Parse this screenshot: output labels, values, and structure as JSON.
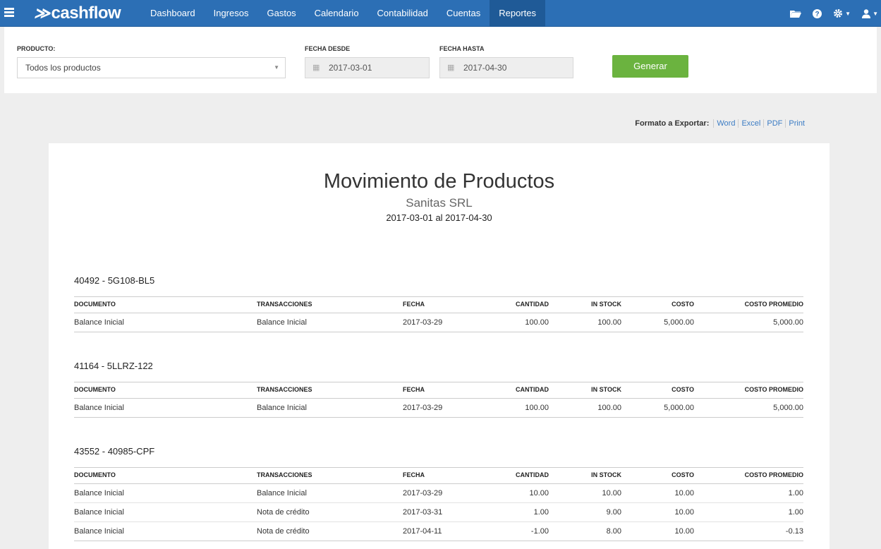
{
  "header": {
    "logo_text": "cashflow",
    "logo_mark": "≫",
    "menu_icon": "hamburger-icon",
    "nav": [
      "Dashboard",
      "Ingresos",
      "Gastos",
      "Calendario",
      "Contabilidad",
      "Cuentas",
      "Reportes"
    ],
    "active_nav": "Reportes",
    "right_icons": [
      "folder-icon",
      "help-icon",
      "gear-icon",
      "user-icon"
    ]
  },
  "filters": {
    "producto_label": "PRODUCTO:",
    "producto_value": "Todos los productos",
    "desde_label": "FECHA DESDE",
    "desde_value": "2017-03-01",
    "hasta_label": "FECHA HASTA",
    "hasta_value": "2017-04-30",
    "generar_label": "Generar"
  },
  "export": {
    "label": "Formato a Exportar:",
    "word": "Word",
    "excel": "Excel",
    "pdf": "PDF",
    "print": "Print"
  },
  "report": {
    "title": "Movimiento de Productos",
    "company": "Sanitas SRL",
    "range": "2017-03-01 al 2017-04-30",
    "columns": {
      "documento": "DOCUMENTO",
      "transacciones": "TRANSACCIONES",
      "fecha": "FECHA",
      "cantidad": "CANTIDAD",
      "in_stock": "IN STOCK",
      "costo": "COSTO",
      "costo_promedio": "COSTO PROMEDIO"
    },
    "products": [
      {
        "name": "40492 - 5G108-BL5",
        "rows": [
          {
            "documento": "Balance Inicial",
            "transacciones": "Balance Inicial",
            "fecha": "2017-03-29",
            "cantidad": "100.00",
            "in_stock": "100.00",
            "costo": "5,000.00",
            "costo_promedio": "5,000.00"
          }
        ]
      },
      {
        "name": "41164 - 5LLRZ-122",
        "rows": [
          {
            "documento": "Balance Inicial",
            "transacciones": "Balance Inicial",
            "fecha": "2017-03-29",
            "cantidad": "100.00",
            "in_stock": "100.00",
            "costo": "5,000.00",
            "costo_promedio": "5,000.00"
          }
        ]
      },
      {
        "name": "43552 - 40985-CPF",
        "rows": [
          {
            "documento": "Balance Inicial",
            "transacciones": "Balance Inicial",
            "fecha": "2017-03-29",
            "cantidad": "10.00",
            "in_stock": "10.00",
            "costo": "10.00",
            "costo_promedio": "1.00"
          },
          {
            "documento": "Balance Inicial",
            "transacciones": "Nota de crédito",
            "fecha": "2017-03-31",
            "cantidad": "1.00",
            "in_stock": "9.00",
            "costo": "10.00",
            "costo_promedio": "1.00"
          },
          {
            "documento": "Balance Inicial",
            "transacciones": "Nota de crédito",
            "fecha": "2017-04-11",
            "cantidad": "-1.00",
            "in_stock": "8.00",
            "costo": "10.00",
            "costo_promedio": "-0.13"
          }
        ]
      }
    ]
  }
}
